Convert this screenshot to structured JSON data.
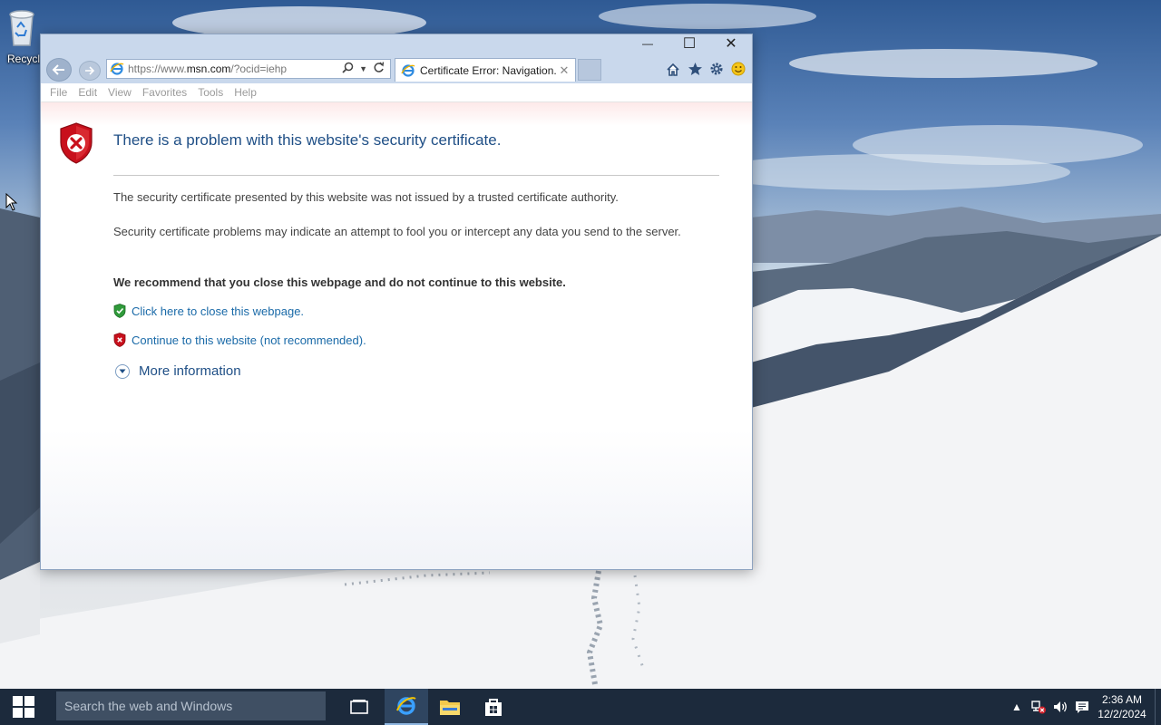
{
  "desktop": {
    "recycle_bin_label": "Recycle Bin"
  },
  "window": {
    "controls": {
      "minimize": "—",
      "maximize": "☐",
      "close": "✕"
    },
    "address": {
      "prefix": "https://www.",
      "domain": "msn.com",
      "suffix": "/?ocid=iehp"
    },
    "tab": {
      "title": "Certificate Error: Navigation...",
      "close": "✕"
    },
    "menu": [
      "File",
      "Edit",
      "View",
      "Favorites",
      "Tools",
      "Help"
    ]
  },
  "page": {
    "title": "There is a problem with this website's security certificate.",
    "para1": "The security certificate presented by this website was not issued by a trusted certificate authority.",
    "para2": "Security certificate problems may indicate an attempt to fool you or intercept any data you send to the server.",
    "recommend": "We recommend that you close this webpage and do not continue to this website.",
    "close_link": "Click here to close this webpage.",
    "continue_link": "Continue to this website (not recommended).",
    "more_info": "More information"
  },
  "taskbar": {
    "search_placeholder": "Search the web and Windows",
    "time": "2:36 AM",
    "date": "12/2/2024"
  },
  "colors": {
    "link": "#1a6aa8",
    "title": "#1f4f86",
    "taskbar": "#1c2a3c"
  }
}
